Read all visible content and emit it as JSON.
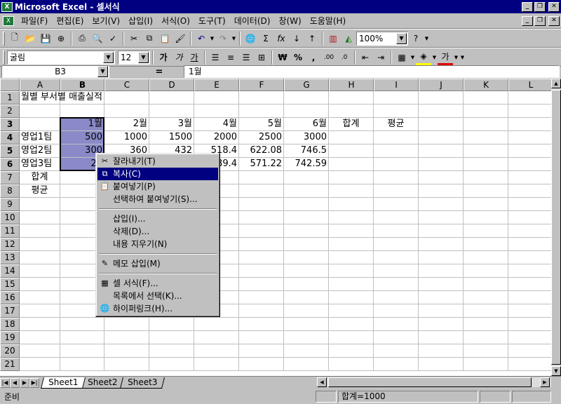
{
  "window": {
    "title": "Microsoft Excel - 셀서식",
    "app_icon": "X"
  },
  "menu": {
    "items": [
      "파일(F)",
      "편집(E)",
      "보기(V)",
      "삽입(I)",
      "서식(O)",
      "도구(T)",
      "데이터(D)",
      "창(W)",
      "도움말(H)"
    ]
  },
  "toolbar": {
    "zoom": "100%",
    "font_name": "굴림",
    "font_size": "12",
    "bold_label": "가",
    "italic_label": "가",
    "underline_label": "가",
    "currency_label": "₩",
    "percent_label": "%",
    "comma_label": ",",
    "font_color_label": "가"
  },
  "formula_bar": {
    "name_box": "B3",
    "equals": "=",
    "content": "1월"
  },
  "grid": {
    "columns": [
      "A",
      "B",
      "C",
      "D",
      "E",
      "F",
      "G",
      "H",
      "I",
      "J",
      "K",
      "L"
    ],
    "rows": [
      "1",
      "2",
      "3",
      "4",
      "5",
      "6",
      "7",
      "8",
      "9",
      "10",
      "11",
      "12",
      "13",
      "14",
      "15",
      "16",
      "17",
      "18",
      "19",
      "20",
      "21"
    ],
    "title": "월별 부서별 매출실적",
    "headers": [
      "1월",
      "2월",
      "3월",
      "4월",
      "5월",
      "6월",
      "합계",
      "평균"
    ],
    "teams": [
      {
        "name": "영업1팀",
        "values": [
          "500",
          "1000",
          "1500",
          "2000",
          "2500",
          "3000"
        ]
      },
      {
        "name": "영업2팀",
        "values": [
          "300",
          "360",
          "432",
          "518.4",
          "622.08",
          "746.5"
        ]
      },
      {
        "name": "영업3팀",
        "values": [
          "20",
          "",
          "",
          "89.4",
          "571.22",
          "742.59"
        ]
      }
    ],
    "total_label": "합계",
    "average_label": "평균"
  },
  "context_menu": {
    "items": [
      {
        "label": "잘라내기(T)",
        "icon": "scissors-icon",
        "glyph": "✂"
      },
      {
        "label": "복사(C)",
        "icon": "copy-icon",
        "glyph": "⧉",
        "highlighted": true
      },
      {
        "label": "붙여넣기(P)",
        "icon": "paste-icon",
        "glyph": "📋"
      },
      {
        "label": "선택하여 붙여넣기(S)...",
        "icon": "",
        "glyph": ""
      },
      {
        "label": "삽입(I)...",
        "icon": "",
        "glyph": ""
      },
      {
        "label": "삭제(D)...",
        "icon": "",
        "glyph": ""
      },
      {
        "label": "내용 지우기(N)",
        "icon": "",
        "glyph": ""
      },
      {
        "label": "메모 삽입(M)",
        "icon": "comment-icon",
        "glyph": "✎"
      },
      {
        "label": "셀 서식(F)...",
        "icon": "format-cells-icon",
        "glyph": "▦"
      },
      {
        "label": "목록에서 선택(K)...",
        "icon": "",
        "glyph": ""
      },
      {
        "label": "하이퍼링크(H)...",
        "icon": "hyperlink-icon",
        "glyph": "🌐"
      }
    ]
  },
  "sheets": {
    "tabs": [
      "Sheet1",
      "Sheet2",
      "Sheet3"
    ],
    "active": "Sheet1"
  },
  "status": {
    "text": "준비",
    "sum": "합계=1000"
  }
}
